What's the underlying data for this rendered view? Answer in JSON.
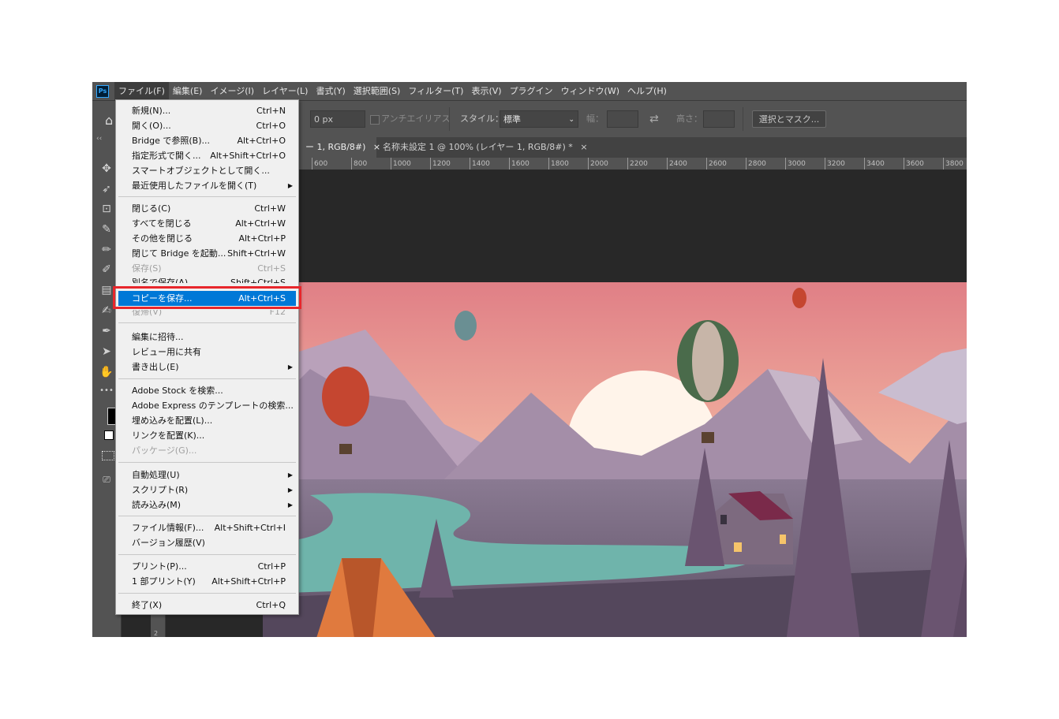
{
  "app": {
    "logo": "Ps"
  },
  "menubar": {
    "items": [
      "ファイル(F)",
      "編集(E)",
      "イメージ(I)",
      "レイヤー(L)",
      "書式(Y)",
      "選択範囲(S)",
      "フィルター(T)",
      "表示(V)",
      "プラグイン",
      "ウィンドウ(W)",
      "ヘルプ(H)"
    ]
  },
  "options": {
    "feather_value": "0 px",
    "antialias_label": "アンチエイリアス",
    "style_label": "スタイル：",
    "style_value": "標準",
    "width_label": "幅：",
    "height_label": "高さ：",
    "select_mask_button": "選択とマスク..."
  },
  "tabs": [
    {
      "label": "ー 1, RGB/8#)",
      "close": "×"
    },
    {
      "label": "名称未設定 1 @ 100% (レイヤー 1, RGB/8#) *",
      "close": "×"
    }
  ],
  "ruler": {
    "ticks": [
      "600",
      "800",
      "1000",
      "1200",
      "1400",
      "1600",
      "1800",
      "2000",
      "2200",
      "2400",
      "2600",
      "2800",
      "3000",
      "3200",
      "3400",
      "3600",
      "3800"
    ],
    "left_mark": "2"
  },
  "toolbar": {
    "collapse_label": "‹‹",
    "more_label": "•••"
  },
  "file_menu": {
    "items": [
      {
        "label": "新規(N)...",
        "shortcut": "Ctrl+N"
      },
      {
        "label": "開く(O)...",
        "shortcut": "Ctrl+O"
      },
      {
        "label": "Bridge で参照(B)...",
        "shortcut": "Alt+Ctrl+O"
      },
      {
        "label": "指定形式で開く...",
        "shortcut": "Alt+Shift+Ctrl+O"
      },
      {
        "label": "スマートオブジェクトとして開く...",
        "shortcut": ""
      },
      {
        "label": "最近使用したファイルを開く(T)",
        "shortcut": ""
      },
      {
        "label": "閉じる(C)",
        "shortcut": "Ctrl+W"
      },
      {
        "label": "すべてを閉じる",
        "shortcut": "Alt+Ctrl+W"
      },
      {
        "label": "その他を閉じる",
        "shortcut": "Alt+Ctrl+P"
      },
      {
        "label": "閉じて Bridge を起動...",
        "shortcut": "Shift+Ctrl+W"
      },
      {
        "label": "保存(S)",
        "shortcut": "Ctrl+S"
      },
      {
        "label": "別名で保存(A)...",
        "shortcut": "Shift+Ctrl+S"
      },
      {
        "label": "コピーを保存...",
        "shortcut": "Alt+Ctrl+S"
      },
      {
        "label": "復帰(V)",
        "shortcut": "F12"
      },
      {
        "label": "編集に招待...",
        "shortcut": ""
      },
      {
        "label": "レビュー用に共有",
        "shortcut": ""
      },
      {
        "label": "書き出し(E)",
        "shortcut": ""
      },
      {
        "label": "Adobe Stock を検索...",
        "shortcut": ""
      },
      {
        "label": "Adobe Express のテンプレートの検索...",
        "shortcut": ""
      },
      {
        "label": "埋め込みを配置(L)...",
        "shortcut": ""
      },
      {
        "label": "リンクを配置(K)...",
        "shortcut": ""
      },
      {
        "label": "パッケージ(G)...",
        "shortcut": ""
      },
      {
        "label": "自動処理(U)",
        "shortcut": ""
      },
      {
        "label": "スクリプト(R)",
        "shortcut": ""
      },
      {
        "label": "読み込み(M)",
        "shortcut": ""
      },
      {
        "label": "ファイル情報(F)...",
        "shortcut": "Alt+Shift+Ctrl+I"
      },
      {
        "label": "バージョン履歴(V)",
        "shortcut": ""
      },
      {
        "label": "プリント(P)...",
        "shortcut": "Ctrl+P"
      },
      {
        "label": "1 部プリント(Y)",
        "shortcut": "Alt+Shift+Ctrl+P"
      },
      {
        "label": "終了(X)",
        "shortcut": "Ctrl+Q"
      }
    ],
    "submenu_arrow": "▶"
  },
  "colors": {
    "highlight": "#0078d7",
    "callout": "#e8262b",
    "menubar": "#535353"
  }
}
